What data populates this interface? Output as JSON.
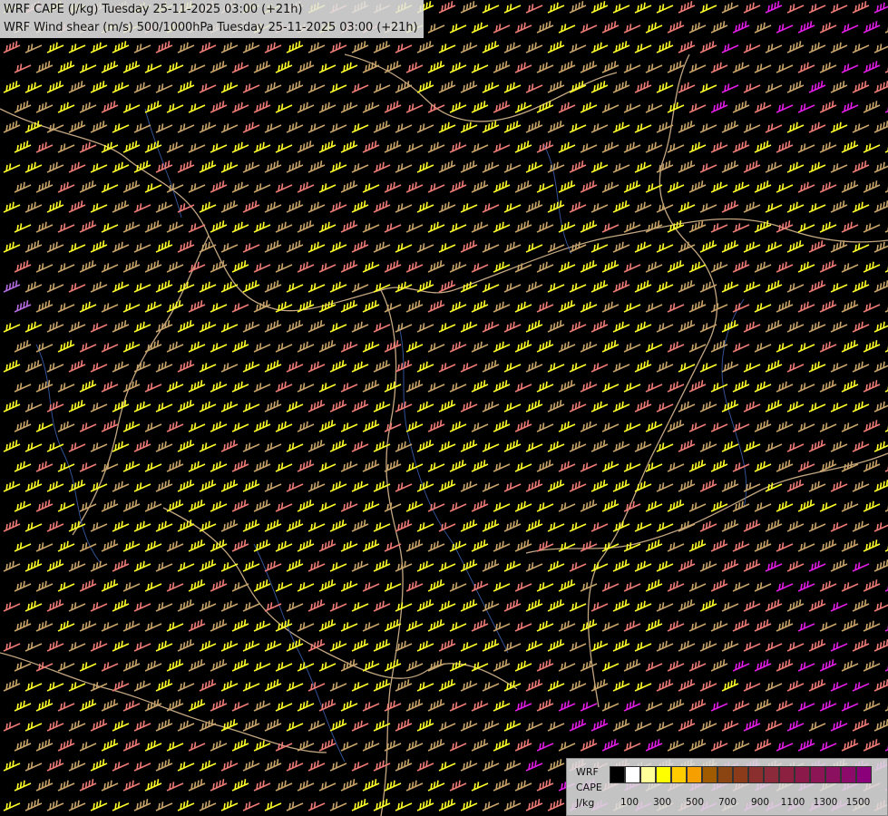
{
  "title": {
    "line1": "WRF CAPE (J/kg) Tuesday 25-11-2025 03:00 (+21h)",
    "line2": "WRF Wind shear (m/s) 500/1000hPa Tuesday 25-11-2025 03:00 (+21h)"
  },
  "legend": {
    "source_line1": "WRF",
    "source_line2": "CAPE",
    "unit": "J/kg",
    "colors": [
      "#000000",
      "#ffffff",
      "#ffff99",
      "#ffff00",
      "#ffcc00",
      "#f5a000",
      "#a05a00",
      "#8b4513",
      "#8b3a1a",
      "#8b2e2e",
      "#8b2a3a",
      "#8b2040",
      "#8b1a4a",
      "#8b1555",
      "#8b1060",
      "#8b0a6a",
      "#8b007a"
    ],
    "tick_labels": [
      "100",
      "300",
      "500",
      "700",
      "900",
      "1100",
      "1300",
      "1500"
    ]
  },
  "map": {
    "barb_colors": {
      "low": "#c9a56b",
      "moderate": "#ffff2a",
      "salmon": "#f07c78",
      "high": "#e21ee6",
      "violet": "#b46de0"
    }
  }
}
